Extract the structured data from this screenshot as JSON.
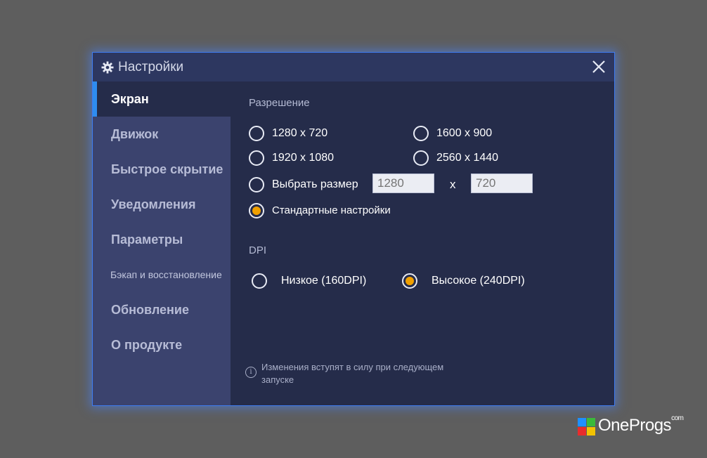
{
  "window": {
    "title": "Настройки",
    "close_label": "✕"
  },
  "sidebar": {
    "items": [
      {
        "label": "Экран",
        "active": true
      },
      {
        "label": "Движок"
      },
      {
        "label": "Быстрое скрытие"
      },
      {
        "label": "Уведомления"
      },
      {
        "label": "Параметры"
      },
      {
        "label": "Бэкап и восстановление"
      },
      {
        "label": "Обновление"
      },
      {
        "label": "О продукте"
      }
    ]
  },
  "resolution": {
    "heading": "Разрешение",
    "options": [
      {
        "label": "1280 x 720",
        "checked": false
      },
      {
        "label": "1600 x 900",
        "checked": false
      },
      {
        "label": "1920 x 1080",
        "checked": false
      },
      {
        "label": "2560 x 1440",
        "checked": false
      },
      {
        "label": "Выбрать размер",
        "checked": false
      },
      {
        "label": "Стандартные настройки",
        "checked": true
      }
    ],
    "custom_width_placeholder": "1280",
    "custom_height_placeholder": "720",
    "separator": "x"
  },
  "dpi": {
    "heading": "DPI",
    "options": [
      {
        "label": "Низкое (160DPI)",
        "checked": false
      },
      {
        "label": "Высокое (240DPI)",
        "checked": true
      }
    ]
  },
  "notice": {
    "text": "Изменения вступят в силу при следующем запуске"
  },
  "brand": {
    "name": "OneProgs",
    "suffix": "com",
    "colors": [
      "#1e90ff",
      "#3aba3a",
      "#e82c2c",
      "#f2c200"
    ]
  },
  "colors": {
    "accent": "#2e8cf0",
    "radio_checked": "#f0a000",
    "dialog_bg": "#252c4a",
    "sidebar_bg": "#3b436e"
  }
}
